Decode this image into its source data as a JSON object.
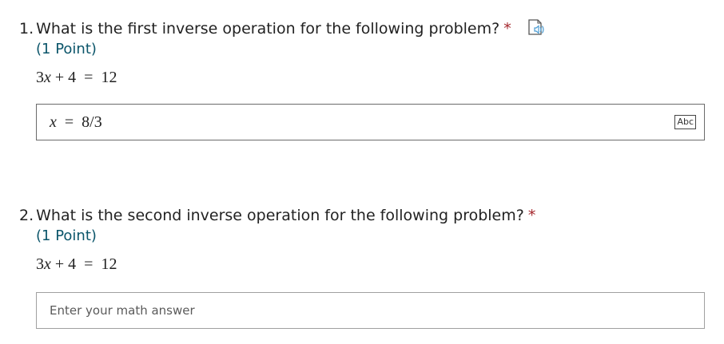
{
  "questions": [
    {
      "number": "1.",
      "text": "What is the first inverse operation for the following problem?",
      "required_mark": "*",
      "has_read_aloud": true,
      "points": "(1 Point)",
      "equation": {
        "coef": "3",
        "var": "x",
        "rest": " + 4  =  12"
      },
      "answer": {
        "var": "x",
        "rest": "  =  8/3",
        "input_mode_badge": "Abc"
      }
    },
    {
      "number": "2.",
      "text": "What is the second inverse operation for the following problem?",
      "required_mark": "*",
      "has_read_aloud": false,
      "points": "(1 Point)",
      "equation": {
        "coef": "3",
        "var": "x",
        "rest": " + 4  =  12"
      },
      "answer": {
        "value": "",
        "placeholder": "Enter your math answer"
      }
    }
  ],
  "icons": {
    "read_aloud": "speaker-read-aloud-icon",
    "input_mode": "abc-text-mode-icon"
  },
  "colors": {
    "required": "#a4262c",
    "points": "#0b556a",
    "read_aloud_accent": "#4a9bd1"
  }
}
